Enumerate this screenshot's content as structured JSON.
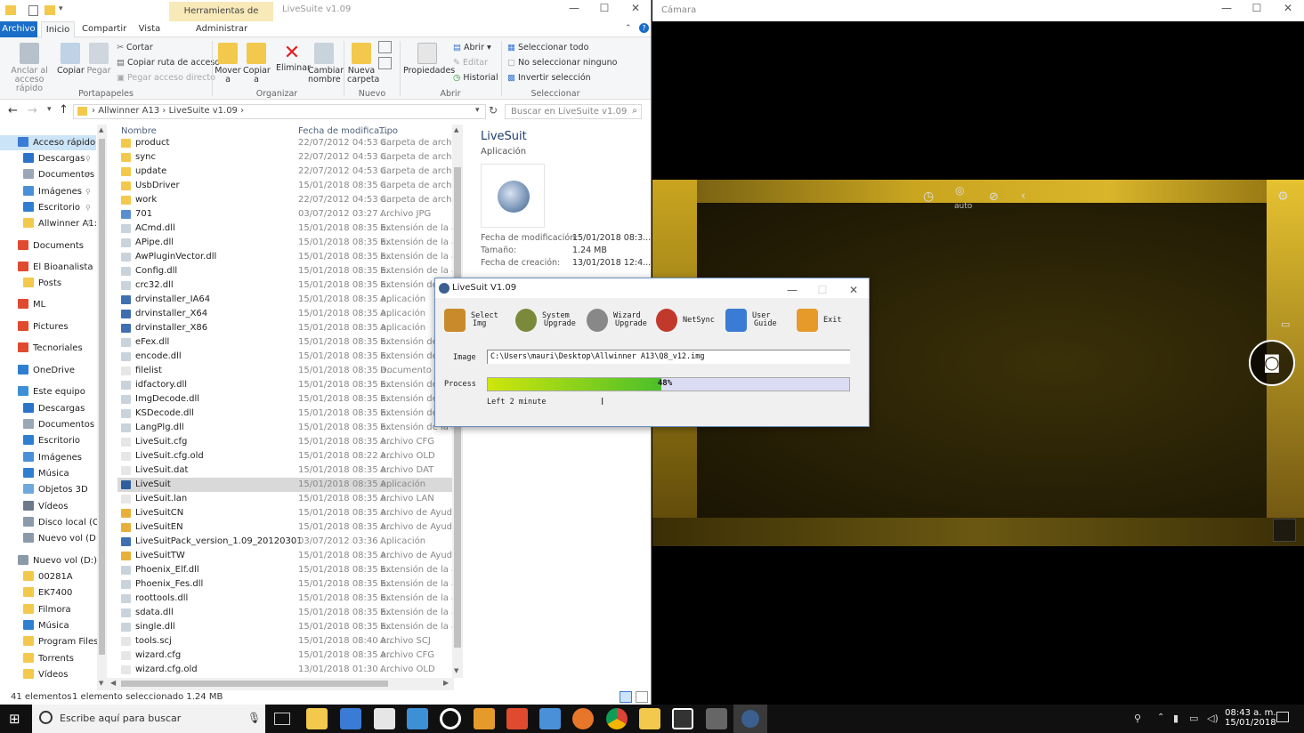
{
  "explorer": {
    "title": "LiveSuite v1.09",
    "context_tab": "Herramientas de aplicación",
    "window_controls": [
      "—",
      "☐",
      "✕"
    ],
    "tabs": [
      {
        "label": "Archivo",
        "active": true
      },
      {
        "label": "Inicio"
      },
      {
        "label": "Compartir"
      },
      {
        "label": "Vista"
      },
      {
        "label": "Administrar"
      }
    ],
    "ribbon": {
      "portapapeles": {
        "anclar": "Anclar al acceso rápido",
        "copiar": "Copiar",
        "pegar": "Pegar",
        "cortar": "Cortar",
        "copiar_ruta": "Copiar ruta de acceso",
        "pegar_acceso": "Pegar acceso directo",
        "group": "Portapapeles"
      },
      "organizar": {
        "mover": "Mover a",
        "copiar_a": "Copiar a",
        "eliminar": "Eliminar",
        "cambiar": "Cambiar nombre",
        "group": "Organizar"
      },
      "nuevo": {
        "nueva_carpeta": "Nueva carpeta",
        "group": "Nuevo"
      },
      "abrir": {
        "propiedades": "Propiedades",
        "abrir": "Abrir",
        "editar": "Editar",
        "historial": "Historial",
        "group": "Abrir"
      },
      "seleccionar": {
        "todo": "Seleccionar todo",
        "ninguno": "No seleccionar ninguno",
        "invertir": "Invertir selección",
        "group": "Seleccionar"
      }
    },
    "breadcrumb": [
      "Allwinner A13",
      "LiveSuite v1.09"
    ],
    "search_placeholder": "Buscar en LiveSuite v1.09",
    "nav": [
      {
        "label": "Acceso rápido",
        "selected": true,
        "color": "#3a7bd5"
      },
      {
        "label": "Descargas",
        "color": "#2a73c8",
        "pinned": true
      },
      {
        "label": "Documentos",
        "color": "#9aa7b5",
        "pinned": true
      },
      {
        "label": "Imágenes",
        "color": "#4a90d9",
        "pinned": true
      },
      {
        "label": "Escritorio",
        "color": "#2f7fd1",
        "pinned": true
      },
      {
        "label": "Allwinner A1:",
        "color": "#f2c94c",
        "pinned": true
      },
      {
        "label": "Documents",
        "color": "#e04a2f"
      },
      {
        "label": "El Bioanalista",
        "color": "#e04a2f"
      },
      {
        "label": "Posts",
        "color": "#f2c94c"
      },
      {
        "label": "ML",
        "color": "#e04a2f"
      },
      {
        "label": "Pictures",
        "color": "#e04a2f"
      },
      {
        "label": "Tecnoriales",
        "color": "#e04a2f"
      },
      {
        "label": "OneDrive",
        "color": "#2f7fd1"
      },
      {
        "label": "Este equipo",
        "color": "#3d8fd6"
      },
      {
        "label": "Descargas",
        "color": "#2a73c8"
      },
      {
        "label": "Documentos",
        "color": "#9aa7b5"
      },
      {
        "label": "Escritorio",
        "color": "#2f7fd1"
      },
      {
        "label": "Imágenes",
        "color": "#4a90d9"
      },
      {
        "label": "Música",
        "color": "#2f7fd1"
      },
      {
        "label": "Objetos 3D",
        "color": "#6fa8dc"
      },
      {
        "label": "Vídeos",
        "color": "#6c7a89"
      },
      {
        "label": "Disco local (C:)",
        "color": "#8a9aa8"
      },
      {
        "label": "Nuevo vol (D:)",
        "color": "#8a9aa8"
      },
      {
        "label": "Nuevo vol (D:)",
        "color": "#8a9aa8"
      },
      {
        "label": "00281A",
        "color": "#f2c94c"
      },
      {
        "label": "EK7400",
        "color": "#f2c94c"
      },
      {
        "label": "Filmora",
        "color": "#f2c94c"
      },
      {
        "label": "Música",
        "color": "#2f7fd1"
      },
      {
        "label": "Program Files",
        "color": "#f2c94c"
      },
      {
        "label": "Torrents",
        "color": "#f2c94c"
      },
      {
        "label": "Vídeos",
        "color": "#f2c94c"
      }
    ],
    "columns": {
      "name": "Nombre",
      "date": "Fecha de modifica...",
      "type": "Tipo"
    },
    "files": [
      {
        "name": "product",
        "date": "22/07/2012 04:53 a...",
        "type": "Carpeta de archivos",
        "color": "#f2c94c"
      },
      {
        "name": "sync",
        "date": "22/07/2012 04:53 a...",
        "type": "Carpeta de archivos",
        "color": "#f2c94c"
      },
      {
        "name": "update",
        "date": "22/07/2012 04:53 a...",
        "type": "Carpeta de archivos",
        "color": "#f2c94c"
      },
      {
        "name": "UsbDriver",
        "date": "15/01/2018 08:35 a...",
        "type": "Carpeta de archivos",
        "color": "#f2c94c"
      },
      {
        "name": "work",
        "date": "22/07/2012 04:53 a...",
        "type": "Carpeta de archivos",
        "color": "#f2c94c"
      },
      {
        "name": "701",
        "date": "03/07/2012 03:27 ...",
        "type": "Archivo JPG",
        "color": "#5a8fcf"
      },
      {
        "name": "ACmd.dll",
        "date": "15/01/2018 08:35 a...",
        "type": "Extensión de la apl...",
        "color": "#c9d3dc"
      },
      {
        "name": "APipe.dll",
        "date": "15/01/2018 08:35 a...",
        "type": "Extensión de la apl...",
        "color": "#c9d3dc"
      },
      {
        "name": "AwPluginVector.dll",
        "date": "15/01/2018 08:35 a...",
        "type": "Extensión de la apl...",
        "color": "#c9d3dc"
      },
      {
        "name": "Config.dll",
        "date": "15/01/2018 08:35 a...",
        "type": "Extensión de la apl...",
        "color": "#c9d3dc"
      },
      {
        "name": "crc32.dll",
        "date": "15/01/2018 08:35 a...",
        "type": "Extensión de la apl...",
        "color": "#c9d3dc"
      },
      {
        "name": "drvinstaller_IA64",
        "date": "15/01/2018 08:35 a...",
        "type": "Aplicación",
        "color": "#3f6fb0"
      },
      {
        "name": "drvinstaller_X64",
        "date": "15/01/2018 08:35 a...",
        "type": "Aplicación",
        "color": "#3f6fb0"
      },
      {
        "name": "drvinstaller_X86",
        "date": "15/01/2018 08:35 a...",
        "type": "Aplicación",
        "color": "#3f6fb0"
      },
      {
        "name": "eFex.dll",
        "date": "15/01/2018 08:35 a...",
        "type": "Extensión de la apl...",
        "color": "#c9d3dc"
      },
      {
        "name": "encode.dll",
        "date": "15/01/2018 08:35 a...",
        "type": "Extensión de la apl...",
        "color": "#c9d3dc"
      },
      {
        "name": "filelist",
        "date": "15/01/2018 08:35 a...",
        "type": "Documento de texto",
        "color": "#e6e6e6"
      },
      {
        "name": "idfactory.dll",
        "date": "15/01/2018 08:35 a...",
        "type": "Extensión de la apl...",
        "color": "#c9d3dc"
      },
      {
        "name": "ImgDecode.dll",
        "date": "15/01/2018 08:35 a...",
        "type": "Extensión de la apl...",
        "color": "#c9d3dc"
      },
      {
        "name": "KSDecode.dll",
        "date": "15/01/2018 08:35 a...",
        "type": "Extensión de la apl...",
        "color": "#c9d3dc"
      },
      {
        "name": "LangPlg.dll",
        "date": "15/01/2018 08:35 a...",
        "type": "Extensión de la apl...",
        "color": "#c9d3dc"
      },
      {
        "name": "LiveSuit.cfg",
        "date": "15/01/2018 08:35 a...",
        "type": "Archivo CFG",
        "color": "#e6e6e6"
      },
      {
        "name": "LiveSuit.cfg.old",
        "date": "15/01/2018 08:22 a...",
        "type": "Archivo OLD",
        "color": "#e6e6e6"
      },
      {
        "name": "LiveSuit.dat",
        "date": "15/01/2018 08:35 a...",
        "type": "Archivo DAT",
        "color": "#e6e6e6"
      },
      {
        "name": "LiveSuit",
        "date": "15/01/2018 08:35 a...",
        "type": "Aplicación",
        "color": "#2f5e9e",
        "selected": true
      },
      {
        "name": "LiveSuit.lan",
        "date": "15/01/2018 08:35 a...",
        "type": "Archivo LAN",
        "color": "#e6e6e6"
      },
      {
        "name": "LiveSuitCN",
        "date": "15/01/2018 08:35 a...",
        "type": "Archivo de Ayuda ...",
        "color": "#e8b03a"
      },
      {
        "name": "LiveSuitEN",
        "date": "15/01/2018 08:35 a...",
        "type": "Archivo de Ayuda ...",
        "color": "#e8b03a"
      },
      {
        "name": "LiveSuitPack_version_1.09_20120301",
        "date": "03/07/2012 03:36 ...",
        "type": "Aplicación",
        "color": "#3f6fb0"
      },
      {
        "name": "LiveSuitTW",
        "date": "15/01/2018 08:35 a...",
        "type": "Archivo de Ayuda ...",
        "color": "#e8b03a"
      },
      {
        "name": "Phoenix_Elf.dll",
        "date": "15/01/2018 08:35 a...",
        "type": "Extensión de la apl...",
        "color": "#c9d3dc"
      },
      {
        "name": "Phoenix_Fes.dll",
        "date": "15/01/2018 08:35 a...",
        "type": "Extensión de la apl...",
        "color": "#c9d3dc"
      },
      {
        "name": "roottools.dll",
        "date": "15/01/2018 08:35 a...",
        "type": "Extensión de la apl...",
        "color": "#c9d3dc"
      },
      {
        "name": "sdata.dll",
        "date": "15/01/2018 08:35 a...",
        "type": "Extensión de la apl...",
        "color": "#c9d3dc"
      },
      {
        "name": "single.dll",
        "date": "15/01/2018 08:35 a...",
        "type": "Extensión de la apl...",
        "color": "#c9d3dc"
      },
      {
        "name": "tools.scj",
        "date": "15/01/2018 08:40 a...",
        "type": "Archivo SCJ",
        "color": "#e6e6e6"
      },
      {
        "name": "wizard.cfg",
        "date": "15/01/2018 08:35 a...",
        "type": "Archivo CFG",
        "color": "#e6e6e6"
      },
      {
        "name": "wizard.cfg.old",
        "date": "13/01/2018 01:30 ...",
        "type": "Archivo OLD",
        "color": "#e6e6e6"
      }
    ],
    "preview": {
      "name": "LiveSuit",
      "kind": "Aplicación",
      "fields": [
        {
          "k": "Fecha de modificación:",
          "v": "15/01/2018 08:3..."
        },
        {
          "k": "Tamaño:",
          "v": "1.24 MB"
        },
        {
          "k": "Fecha de creación:",
          "v": "13/01/2018 12:4..."
        }
      ]
    },
    "status": {
      "count": "41 elementos",
      "selection": "1 elemento seleccionado  1.24 MB"
    }
  },
  "camera": {
    "title": "Cámara",
    "auto_label": "auto",
    "window_controls": [
      "—",
      "☐",
      "✕"
    ]
  },
  "livesuit": {
    "title": "LiveSuit V1.09",
    "window_controls": [
      "—",
      "☐",
      "✕"
    ],
    "buttons": [
      {
        "l1": "Select",
        "l2": "Img",
        "icon": "cube-icon",
        "color": "#c88a2a"
      },
      {
        "l1": "System",
        "l2": "Upgrade",
        "icon": "gear-icon",
        "color": "#7a8a3a"
      },
      {
        "l1": "Wizard",
        "l2": "Upgrade",
        "icon": "wizard-gear-icon",
        "color": "#888888"
      },
      {
        "l1": "NetSync",
        "l2": "",
        "icon": "globe-icon",
        "color": "#c0392b"
      },
      {
        "l1": "User",
        "l2": "Guide",
        "icon": "book-icon",
        "color": "#3a7bd5"
      },
      {
        "l1": "Exit",
        "l2": "",
        "icon": "exit-person-icon",
        "color": "#e69a2a"
      }
    ],
    "image_label": "Image",
    "image_path": "C:\\Users\\mauri\\Desktop\\Allwinner A13\\Q8_v12.img",
    "process_label": "Process",
    "progress": 48,
    "progress_text": "48%",
    "left_text": "Left 2 minute"
  },
  "taskbar": {
    "search_placeholder": "Escribe aquí para buscar",
    "time": "08:43 a. m.",
    "date": "15/01/2018"
  }
}
